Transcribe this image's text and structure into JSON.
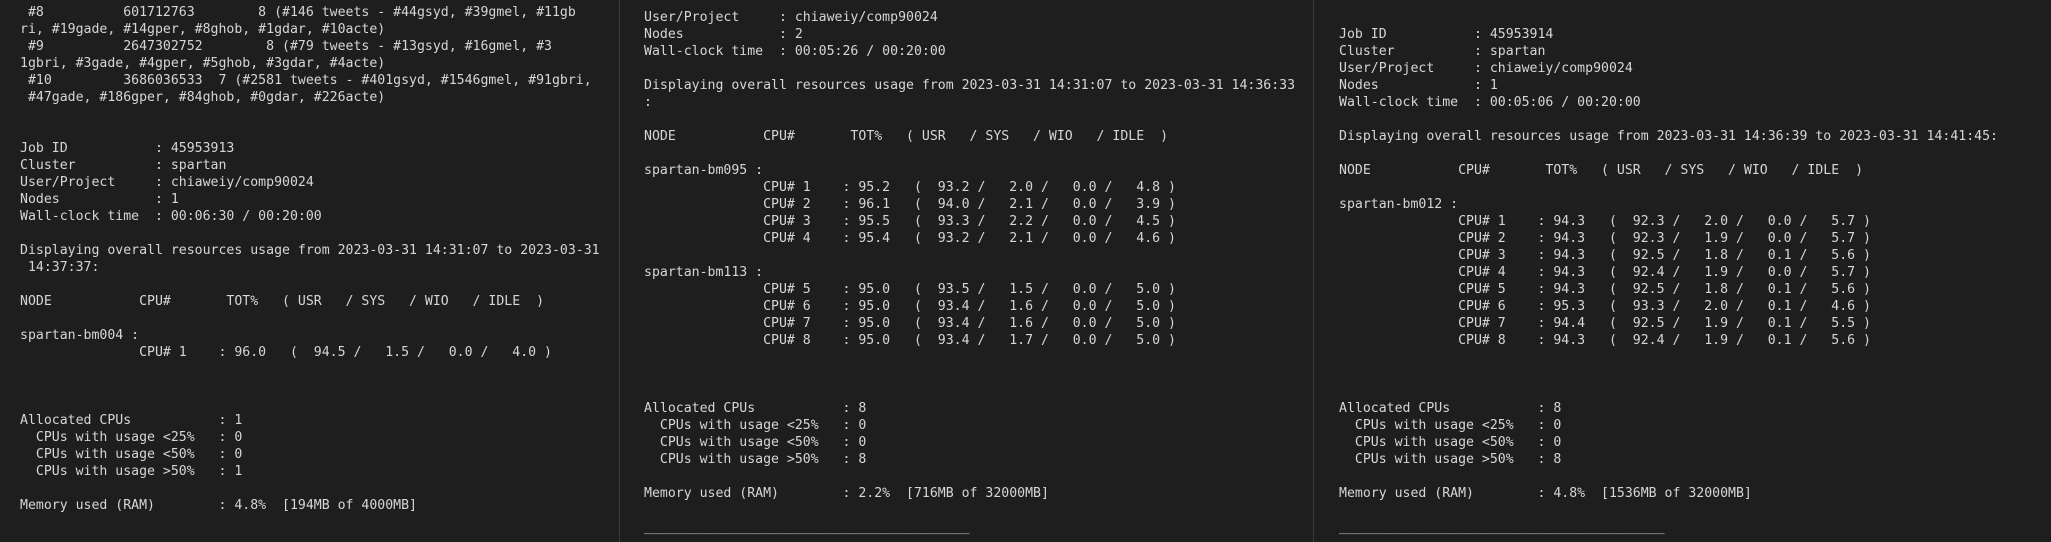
{
  "panes": [
    {
      "text": " #8          601712763        8 (#146 tweets - #44gsyd, #39gmel, #11gb\nri, #19gade, #14gper, #8ghob, #1gdar, #10acte)\n #9          2647302752        8 (#79 tweets - #13gsyd, #16gmel, #3\n1gbri, #3gade, #4gper, #5ghob, #3gdar, #4acte)\n #10         3686036533  7 (#2581 tweets - #401gsyd, #1546gmel, #91gbri,\n #47gade, #186gper, #84ghob, #0gdar, #226acte)\n\n\nJob ID           : 45953913\nCluster          : spartan\nUser/Project     : chiaweiy/comp90024\nNodes            : 1\nWall-clock time  : 00:06:30 / 00:20:00\n\nDisplaying overall resources usage from 2023-03-31 14:31:07 to 2023-03-31\n 14:37:37:\n\nNODE           CPU#       TOT%   ( USR   / SYS   / WIO   / IDLE  )\n\nspartan-bm004 :\n               CPU# 1    : 96.0   (  94.5 /   1.5 /   0.0 /   4.0 )\n\n\n\nAllocated CPUs           : 1\n  CPUs with usage <25%   : 0\n  CPUs with usage <50%   : 0\n  CPUs with usage >50%   : 1\n\nMemory used (RAM)        : 4.8%  [194MB of 4000MB]\n\n_________________________________________"
    },
    {
      "text": "User/Project     : chiaweiy/comp90024\nNodes            : 2\nWall-clock time  : 00:05:26 / 00:20:00\n\nDisplaying overall resources usage from 2023-03-31 14:31:07 to 2023-03-31 14:36:33\n:\n\nNODE           CPU#       TOT%   ( USR   / SYS   / WIO   / IDLE  )\n\nspartan-bm095 :\n               CPU# 1    : 95.2   (  93.2 /   2.0 /   0.0 /   4.8 )\n               CPU# 2    : 96.1   (  94.0 /   2.1 /   0.0 /   3.9 )\n               CPU# 3    : 95.5   (  93.3 /   2.2 /   0.0 /   4.5 )\n               CPU# 4    : 95.4   (  93.2 /   2.1 /   0.0 /   4.6 )\n\nspartan-bm113 :\n               CPU# 5    : 95.0   (  93.5 /   1.5 /   0.0 /   5.0 )\n               CPU# 6    : 95.0   (  93.4 /   1.6 /   0.0 /   5.0 )\n               CPU# 7    : 95.0   (  93.4 /   1.6 /   0.0 /   5.0 )\n               CPU# 8    : 95.0   (  93.4 /   1.7 /   0.0 /   5.0 )\n\n\n\nAllocated CPUs           : 8\n  CPUs with usage <25%   : 0\n  CPUs with usage <50%   : 0\n  CPUs with usage >50%   : 8\n\nMemory used (RAM)        : 2.2%  [716MB of 32000MB]\n\n_________________________________________"
    },
    {
      "text": "Job ID           : 45953914\nCluster          : spartan\nUser/Project     : chiaweiy/comp90024\nNodes            : 1\nWall-clock time  : 00:05:06 / 00:20:00\n\nDisplaying overall resources usage from 2023-03-31 14:36:39 to 2023-03-31 14:41:45:\n\nNODE           CPU#       TOT%   ( USR   / SYS   / WIO   / IDLE  )\n\nspartan-bm012 :\n               CPU# 1    : 94.3   (  92.3 /   2.0 /   0.0 /   5.7 )\n               CPU# 2    : 94.3   (  92.3 /   1.9 /   0.0 /   5.7 )\n               CPU# 3    : 94.3   (  92.5 /   1.8 /   0.1 /   5.6 )\n               CPU# 4    : 94.3   (  92.4 /   1.9 /   0.0 /   5.7 )\n               CPU# 5    : 94.3   (  92.5 /   1.8 /   0.1 /   5.6 )\n               CPU# 6    : 95.3   (  93.3 /   2.0 /   0.1 /   4.6 )\n               CPU# 7    : 94.4   (  92.5 /   1.9 /   0.1 /   5.5 )\n               CPU# 8    : 94.3   (  92.4 /   1.9 /   0.1 /   5.6 )\n\n\n\nAllocated CPUs           : 8\n  CPUs with usage <25%   : 0\n  CPUs with usage <50%   : 0\n  CPUs with usage >50%   : 8\n\nMemory used (RAM)        : 4.8%  [1536MB of 32000MB]\n\n_________________________________________"
    }
  ]
}
